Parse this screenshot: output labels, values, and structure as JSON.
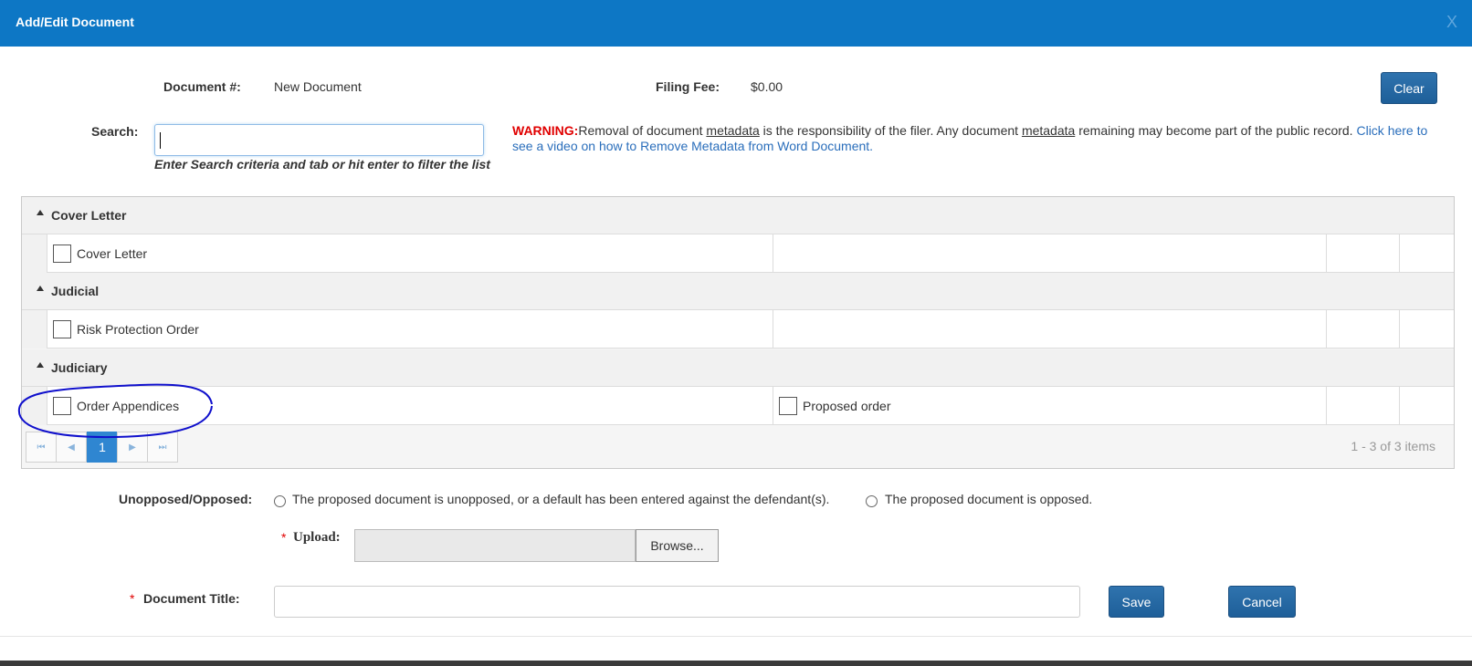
{
  "dialog": {
    "title": "Add/Edit Document",
    "close_label": "X"
  },
  "header": {
    "document_number_label": "Document #:",
    "document_number_value": "New Document",
    "filing_fee_label": "Filing Fee:",
    "filing_fee_value": "$0.00",
    "clear_label": "Clear"
  },
  "search": {
    "label": "Search:",
    "value": "",
    "hint": "Enter Search criteria and tab or hit enter to filter the list"
  },
  "warning": {
    "prefix": "WARNING:",
    "text_1": "Removal of document ",
    "metadata_1": "metadata",
    "text_2": " is the responsibility of the filer. Any document ",
    "metadata_2": "metadata",
    "text_3": " remaining may become part of the public record. ",
    "link": "Click here to see a video on how to Remove Metadata from Word Document."
  },
  "grid": {
    "groups": [
      {
        "name": "Cover Letter",
        "items": [
          "Cover Letter",
          ""
        ]
      },
      {
        "name": "Judicial",
        "items": [
          "Risk Protection Order",
          ""
        ]
      },
      {
        "name": "Judiciary",
        "items": [
          "Order Appendices",
          "Proposed order"
        ]
      }
    ],
    "pager": {
      "current_page": "1",
      "info": "1 - 3 of 3 items"
    }
  },
  "opposition": {
    "label": "Unopposed/Opposed:",
    "option_1": "The proposed document is unopposed, or a default has been entered against the defendant(s).",
    "option_2": "The proposed document is opposed."
  },
  "upload": {
    "required_mark": "*",
    "label": "Upload:",
    "browse_label": "Browse..."
  },
  "document_title": {
    "required_mark": "*",
    "label": "Document Title:",
    "value": ""
  },
  "actions": {
    "save_label": "Save",
    "cancel_label": "Cancel"
  },
  "colors": {
    "titlebar": "#0d77c5",
    "button": "#1e5f99",
    "warning": "#e00000",
    "link": "#2a6ebb",
    "annotation": "#1010cc"
  }
}
